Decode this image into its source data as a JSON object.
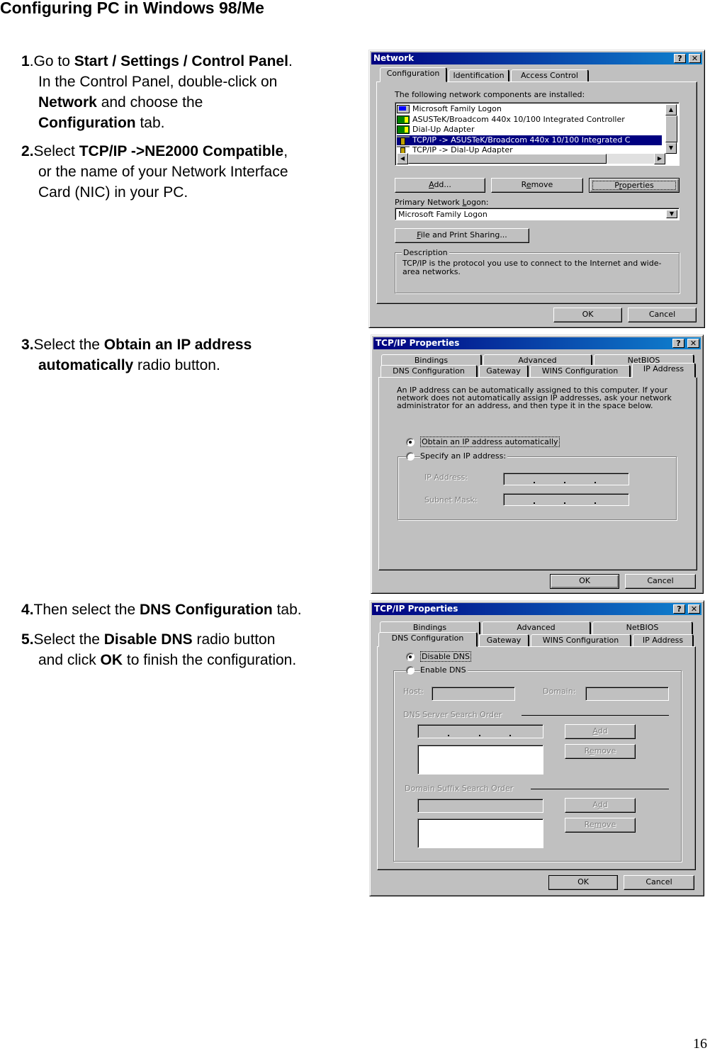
{
  "page": {
    "title": "Configuring PC in Windows 98/Me",
    "page_number": "16"
  },
  "steps": [
    {
      "num": "1",
      "parts": [
        {
          "t": "Go to ",
          "b": false
        },
        {
          "t": "Start / Settings / Control Panel",
          "b": true
        },
        {
          "t": ".",
          "b": false
        }
      ],
      "cont": [
        [
          {
            "t": "In the Control Panel, double-click on",
            "b": false
          }
        ],
        [
          {
            "t": "Network",
            "b": true
          },
          {
            "t": " and choose the",
            "b": false
          }
        ],
        [
          {
            "t": "Configuration",
            "b": true
          },
          {
            "t": " tab.",
            "b": false
          }
        ]
      ]
    },
    {
      "num": "2",
      "parts": [
        {
          "t": "Select ",
          "b": false
        },
        {
          "t": "TCP/IP ->NE2000 Compatible",
          "b": true
        },
        {
          "t": ",",
          "b": false
        }
      ],
      "cont": [
        [
          {
            "t": "or the name of your Network Interface",
            "b": false
          }
        ],
        [
          {
            "t": "Card (NIC) in your PC.",
            "b": false
          }
        ]
      ]
    },
    {
      "num": "3",
      "parts": [
        {
          "t": "Select the ",
          "b": false
        },
        {
          "t": "Obtain an IP address",
          "b": true
        }
      ],
      "cont": [
        [
          {
            "t": "automatically",
            "b": true
          },
          {
            "t": " radio button.",
            "b": false
          }
        ]
      ]
    },
    {
      "num": "4",
      "parts": [
        {
          "t": "Then select the ",
          "b": false
        },
        {
          "t": "DNS Configuration",
          "b": true
        },
        {
          "t": " tab.",
          "b": false
        }
      ],
      "cont": []
    },
    {
      "num": "5",
      "parts": [
        {
          "t": "Select the ",
          "b": false
        },
        {
          "t": "Disable DNS",
          "b": true
        },
        {
          "t": " radio button",
          "b": false
        }
      ],
      "cont": [
        [
          {
            "t": "and click ",
            "b": false
          },
          {
            "t": "OK",
            "b": true
          },
          {
            "t": " to finish the configuration.",
            "b": false
          }
        ]
      ]
    }
  ],
  "network_dialog": {
    "title": "Network",
    "help_glyph": "?",
    "close_glyph": "✕",
    "tabs": [
      "Configuration",
      "Identification",
      "Access Control"
    ],
    "active_tab": "Configuration",
    "components_label": "The following network components are installed:",
    "components": [
      {
        "label": "Microsoft Family Logon",
        "icon": "computer-icon",
        "selected": false
      },
      {
        "label": "ASUSTeK/Broadcom 440x 10/100 Integrated Controller",
        "icon": "network-card-icon",
        "selected": false
      },
      {
        "label": "Dial-Up Adapter",
        "icon": "network-card-icon",
        "selected": false
      },
      {
        "label": "TCP/IP -> ASUSTeK/Broadcom 440x 10/100 Integrated C",
        "icon": "protocol-icon",
        "selected": true
      },
      {
        "label": "TCP/IP -> Dial-Up Adapter",
        "icon": "protocol-icon",
        "selected": false
      }
    ],
    "add_button": "Add...",
    "remove_button": "Remove",
    "properties_button": "Properties",
    "primary_logon_label": "Primary Network Logon:",
    "primary_logon_value": "Microsoft Family Logon",
    "file_print_button": "File and Print Sharing...",
    "description_label": "Description",
    "description_text": "TCP/IP is the protocol you use to connect to the Internet and wide-area networks.",
    "ok_button": "OK",
    "cancel_button": "Cancel"
  },
  "ip_dialog": {
    "title": "TCP/IP Properties",
    "help_glyph": "?",
    "close_glyph": "✕",
    "tabs_row1": [
      "Bindings",
      "Advanced",
      "NetBIOS"
    ],
    "tabs_row2": [
      "DNS Configuration",
      "Gateway",
      "WINS Configuration",
      "IP Address"
    ],
    "active_tab": "IP Address",
    "info_text": "An IP address can be automatically assigned to this computer. If your network does not automatically assign IP addresses, ask your network administrator for an address, and then type it in the space below.",
    "obtain_auto_label": "Obtain an IP address automatically",
    "obtain_auto_checked": true,
    "specify_label": "Specify an IP address:",
    "specify_checked": false,
    "ip_address_label": "IP Address:",
    "subnet_mask_label": "Subnet Mask:",
    "ok_button": "OK",
    "cancel_button": "Cancel"
  },
  "dns_dialog": {
    "title": "TCP/IP Properties",
    "help_glyph": "?",
    "close_glyph": "✕",
    "tabs_row1": [
      "Bindings",
      "Advanced",
      "NetBIOS"
    ],
    "tabs_row2": [
      "DNS Configuration",
      "Gateway",
      "WINS Configuration",
      "IP Address"
    ],
    "active_tab": "DNS Configuration",
    "disable_dns_label": "Disable DNS",
    "disable_dns_checked": true,
    "enable_dns_label": "Enable DNS",
    "enable_dns_checked": false,
    "host_label": "Host:",
    "domain_label": "Domain:",
    "dns_server_order_label": "DNS Server Search Order",
    "add_button": "Add",
    "remove_button": "Remove",
    "domain_suffix_order_label": "Domain Suffix Search Order",
    "add2_button": "Add",
    "remove2_button": "Remove",
    "ok_button": "OK",
    "cancel_button": "Cancel"
  }
}
